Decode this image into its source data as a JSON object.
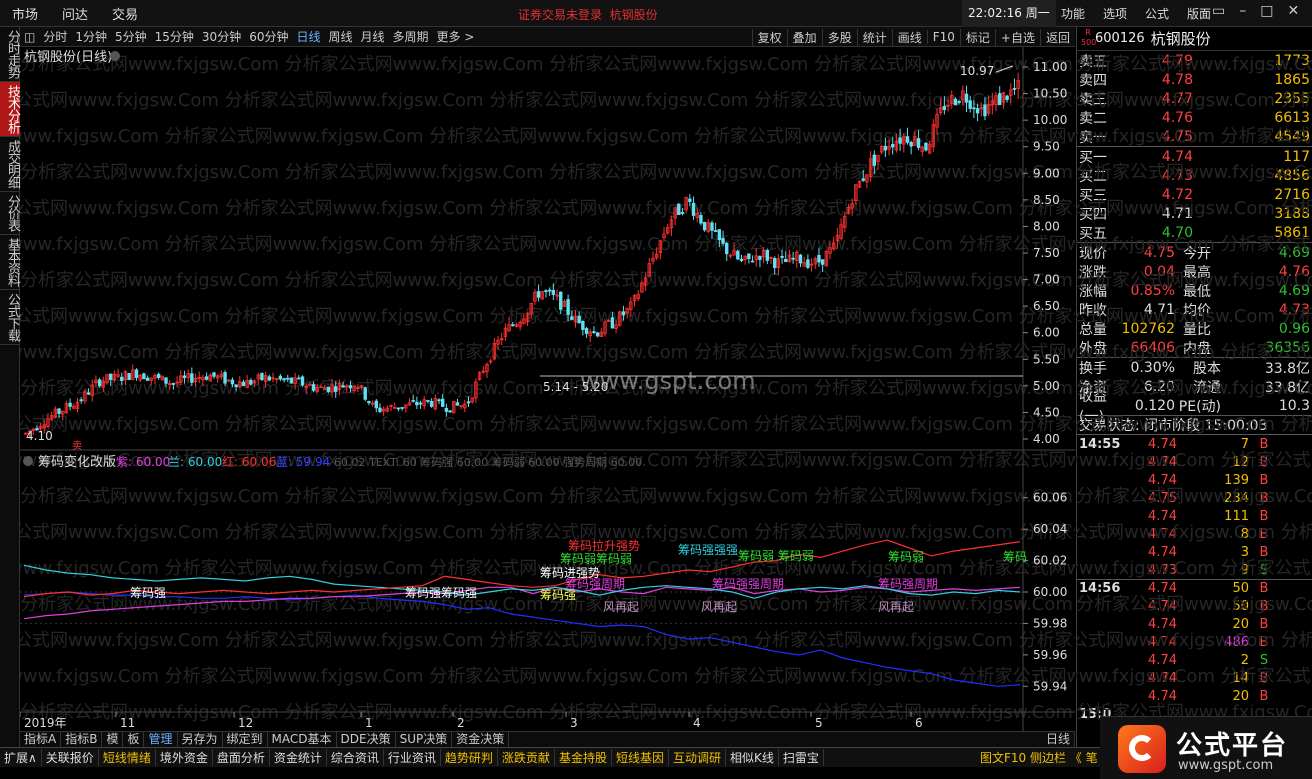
{
  "topbar": {
    "menus": [
      "市场",
      "问达",
      "交易"
    ],
    "notice": "证券交易未登录",
    "stock": "杭钢股份",
    "clock": "22:02:16 周一",
    "right_menus": [
      "功能",
      "选项",
      "公式",
      "版面"
    ],
    "win_buttons": [
      "▭",
      "–",
      "□",
      "✕"
    ]
  },
  "side_tabs": [
    "分时走势",
    "技术分析",
    "成交明细",
    "分价表",
    "基本资料",
    "公式下载"
  ],
  "period_bar": {
    "periods": [
      "分时",
      "1分钟",
      "5分钟",
      "15分钟",
      "30分钟",
      "60分钟",
      "日线",
      "周线",
      "月线",
      "多周期",
      "更多 >"
    ],
    "active": "日线",
    "tools": [
      "复权",
      "叠加",
      "多股",
      "统计",
      "画线",
      "F10",
      "标记",
      "+自选",
      "返回"
    ]
  },
  "main_chart": {
    "title": "杭钢股份(日线)",
    "y_ticks": [
      "11.00",
      "10.50",
      "10.00",
      "9.50",
      "9.00",
      "8.50",
      "8.00",
      "7.50",
      "7.00",
      "6.50",
      "6.00",
      "5.50",
      "5.00",
      "4.50",
      "4.00"
    ],
    "high_label": "10.97",
    "low_label": "4.10",
    "range_label": "5.14 - 5.20",
    "watermark_center": "www.gspt.com"
  },
  "indicator": {
    "name": "筹码变化改版",
    "params": [
      {
        "label": "紫: 60.00",
        "color": "#e040e0"
      },
      {
        "label": "兰: 60.00",
        "color": "#30d0e0"
      },
      {
        "label": "红: 60.06",
        "color": "#ff3030"
      },
      {
        "label": "蓝: 59.94",
        "color": "#3040ff"
      }
    ],
    "overlay": "60.02  TEXT: 60  筹码强  60.00  筹码弱  60.00  强势周期  60.00",
    "y_ticks": [
      "60.06",
      "60.04",
      "60.02",
      "60.00",
      "59.98",
      "59.96",
      "59.94"
    ],
    "annotations": [
      {
        "text": "筹码强",
        "color": "#ffffff"
      },
      {
        "text": "筹码强筹码强",
        "color": "#ffffff"
      },
      {
        "text": "筹码强",
        "color": "#ffff60"
      },
      {
        "text": "筹码进强势",
        "color": "#ffffff"
      },
      {
        "text": "筹码拉升强势",
        "color": "#ff3030"
      },
      {
        "text": "筹码弱筹码弱",
        "color": "#30e030"
      },
      {
        "text": "筹码强周期",
        "color": "#e040e0"
      },
      {
        "text": "风再起",
        "color": "#c090c0"
      },
      {
        "text": "风再起",
        "color": "#c090c0"
      },
      {
        "text": "筹码强强强",
        "color": "#30d0e0"
      },
      {
        "text": "筹码弱 筹码弱",
        "color": "#30e030"
      },
      {
        "text": "筹码强强周期",
        "color": "#e040e0"
      },
      {
        "text": "筹码弱",
        "color": "#30e030"
      },
      {
        "text": "筹码强周期",
        "color": "#e040e0"
      },
      {
        "text": "风再起",
        "color": "#c090c0"
      },
      {
        "text": "筹码",
        "color": "#30e030"
      }
    ],
    "sell_marker": "卖"
  },
  "x_axis": {
    "labels": [
      "2019年",
      "11",
      "12",
      "1",
      "2",
      "3",
      "4",
      "5",
      "6"
    ],
    "period": "日线"
  },
  "indicator_tabs": [
    "指标A",
    "指标B",
    "模",
    "板",
    "管理",
    "另存为",
    "绑定到",
    "MACD基本",
    "DDE决策",
    "SUP决策",
    "资金决策"
  ],
  "indicator_tabs_active": "管理",
  "bottom_bar": {
    "items": [
      "扩展∧",
      "关联报价",
      "短线情绪",
      "境外资金",
      "盘面分析",
      "资金统计",
      "综合资讯",
      "行业资讯",
      "趋势研判",
      "涨跌贡献",
      "基金持股",
      "短线基因",
      "互动调研",
      "相似K线",
      "扫雷宝"
    ],
    "highlighted": [
      "短线情绪",
      "趋势研判",
      "涨跌贡献",
      "基金持股",
      "短线基因",
      "互动调研"
    ],
    "right": "图文F10 侧边栏 《  笔"
  },
  "quote": {
    "badge": "R 500",
    "code": "600126",
    "name": "杭钢股份",
    "asks": [
      {
        "label": "卖五",
        "price": "4.79",
        "vol": "1773"
      },
      {
        "label": "卖四",
        "price": "4.78",
        "vol": "1865"
      },
      {
        "label": "卖三",
        "price": "4.77",
        "vol": "2355"
      },
      {
        "label": "卖二",
        "price": "4.76",
        "vol": "6613"
      },
      {
        "label": "卖一",
        "price": "4.75",
        "vol": "4549"
      }
    ],
    "bids": [
      {
        "label": "买一",
        "price": "4.74",
        "vol": "117"
      },
      {
        "label": "买二",
        "price": "4.73",
        "vol": "4856"
      },
      {
        "label": "买三",
        "price": "4.72",
        "vol": "2716"
      },
      {
        "label": "买四",
        "price": "4.71",
        "vol": "3188"
      },
      {
        "label": "买五",
        "price": "4.70",
        "vol": "5861"
      }
    ],
    "stats": [
      {
        "l1": "现价",
        "v1": "4.75",
        "c1": "red",
        "l2": "今开",
        "v2": "4.69",
        "c2": "grn"
      },
      {
        "l1": "涨跌",
        "v1": "0.04",
        "c1": "red",
        "l2": "最高",
        "v2": "4.76",
        "c2": "red"
      },
      {
        "l1": "涨幅",
        "v1": "0.85%",
        "c1": "red",
        "l2": "最低",
        "v2": "4.69",
        "c2": "grn"
      },
      {
        "l1": "昨收",
        "v1": "4.71",
        "c1": "wht",
        "l2": "均价",
        "v2": "4.73",
        "c2": "red"
      },
      {
        "l1": "总量",
        "v1": "102762",
        "c1": "yel",
        "l2": "量比",
        "v2": "0.96",
        "c2": "grn"
      },
      {
        "l1": "外盘",
        "v1": "66406",
        "c1": "red",
        "l2": "内盘",
        "v2": "36356",
        "c2": "grn"
      }
    ],
    "stats2": [
      {
        "l1": "换手",
        "v1": "0.30%",
        "l2": "股本",
        "v2": "33.8亿"
      },
      {
        "l1": "净资",
        "v1": "6.20",
        "l2": "流通",
        "v2": "33.8亿"
      },
      {
        "l1": "收益(一)",
        "v1": "0.120",
        "l2": "PE(动)",
        "v2": "10.3"
      }
    ],
    "trade_status": "交易状态: 闭市阶段 15:00:03",
    "ticks": [
      {
        "t": "14:55",
        "p": "4.74",
        "v": "7",
        "s": "B"
      },
      {
        "t": "",
        "p": "4.74",
        "v": "12",
        "s": "B"
      },
      {
        "t": "",
        "p": "4.74",
        "v": "139",
        "s": "B"
      },
      {
        "t": "",
        "p": "4.75",
        "v": "234",
        "s": "B"
      },
      {
        "t": "",
        "p": "4.74",
        "v": "111",
        "s": "B"
      },
      {
        "t": "",
        "p": "4.74",
        "v": "8",
        "s": "B"
      },
      {
        "t": "",
        "p": "4.74",
        "v": "3",
        "s": "B"
      },
      {
        "t": "",
        "p": "4.73",
        "v": "9",
        "s": "S"
      },
      {
        "t": "14:56",
        "p": "4.74",
        "v": "50",
        "s": "B"
      },
      {
        "t": "",
        "p": "4.74",
        "v": "50",
        "s": "B"
      },
      {
        "t": "",
        "p": "4.74",
        "v": "20",
        "s": "B"
      },
      {
        "t": "",
        "p": "4.74",
        "v": "486",
        "s": "B"
      },
      {
        "t": "",
        "p": "4.74",
        "v": "2",
        "s": "S"
      },
      {
        "t": "",
        "p": "4.74",
        "v": "14",
        "s": "B"
      },
      {
        "t": "",
        "p": "4.74",
        "v": "20",
        "s": "B"
      },
      {
        "t": "15:0",
        "p": "",
        "v": "",
        "s": ""
      }
    ]
  },
  "logo": {
    "title": "公式平台",
    "url": "www.gspt.com"
  },
  "watermark_text": "分析家公式网www.fxjgsw.Com",
  "colors": {
    "up": "#ff3030",
    "down": "#60e0f0",
    "bg": "#000000",
    "accent_red": "#b01818"
  },
  "chart_data": {
    "type": "candlestick",
    "title": "杭钢股份(日线)",
    "x_labels": [
      "2019年",
      "11",
      "12",
      "1",
      "2",
      "3",
      "4",
      "5",
      "6"
    ],
    "ylim": [
      4.0,
      11.0
    ],
    "close_path": [
      4.1,
      4.35,
      4.55,
      4.75,
      5.1,
      5.15,
      5.25,
      5.15,
      5.05,
      5.15,
      5.2,
      5.1,
      5.05,
      5.15,
      5.1,
      5.05,
      4.95,
      5.0,
      5.05,
      4.55,
      4.6,
      4.65,
      4.7,
      4.6,
      4.65,
      5.4,
      6.0,
      6.3,
      6.8,
      6.6,
      6.2,
      6.0,
      6.2,
      6.5,
      7.3,
      8.1,
      8.5,
      8.0,
      7.6,
      7.3,
      7.5,
      7.3,
      7.4,
      7.3,
      7.6,
      8.6,
      9.2,
      9.6,
      9.7,
      9.5,
      10.3,
      10.5,
      10.2,
      10.4,
      10.6
    ],
    "high": 10.97,
    "low": 4.1,
    "indicator": {
      "ylim": [
        59.93,
        60.07
      ],
      "red": [
        59.997,
        59.999,
        60.0,
        59.998,
        59.999,
        60.001,
        60.0,
        59.999,
        60.0,
        60.001,
        60.0,
        59.999,
        60.0,
        60.001,
        60.0,
        60.001,
        60.002,
        60.003,
        60.004,
        60.01,
        60.008,
        60.006,
        60.004,
        60.003,
        60.004,
        60.008,
        60.011,
        60.009,
        60.01,
        60.012,
        60.014,
        60.013,
        60.016,
        60.019,
        60.02,
        60.024,
        60.022,
        60.026,
        60.03,
        60.033,
        60.028,
        60.023,
        60.026,
        60.028,
        60.03,
        60.032
      ],
      "cyan": [
        60.017,
        60.014,
        60.012,
        60.011,
        60.009,
        60.008,
        60.007,
        60.008,
        60.009,
        60.008,
        60.007,
        60.009,
        60.01,
        60.008,
        60.005,
        60.004,
        60.003,
        60.002,
        60.001,
        60.0,
        59.998,
        60.0,
        60.002,
        60.001,
        60.003,
        60.001,
        59.998,
        60.001,
        60.003,
        60.004,
        60.003,
        60.002,
        60.0,
        59.996,
        60.0,
        60.002,
        60.003,
        60.002,
        60.004,
        60.002,
        59.999,
        59.998,
        60.0,
        59.999,
        60.001,
        60.0
      ],
      "magenta": [
        59.983,
        59.985,
        59.986,
        59.988,
        59.989,
        59.99,
        59.991,
        59.992,
        59.993,
        59.994,
        59.994,
        59.995,
        59.996,
        59.996,
        59.997,
        59.997,
        59.998,
        59.999,
        60.0,
        59.999,
        60.001,
        60.003,
        60.003,
        59.999,
        60.003,
        60.0,
        60.002,
        60.0,
        59.999,
        60.003,
        60.002,
        60.001,
        60.003,
        59.999,
        60.001,
        60.002,
        60.0,
        60.001,
        60.003,
        60.002,
        60.0,
        60.001,
        60.002,
        60.001,
        60.002,
        60.003
      ],
      "blue": [
        59.998,
        59.999,
        60.0,
        59.999,
        59.998,
        59.998,
        59.997,
        59.997,
        59.996,
        59.996,
        59.997,
        59.996,
        59.995,
        59.996,
        59.997,
        59.998,
        59.996,
        59.995,
        59.994,
        59.992,
        59.989,
        59.99,
        59.986,
        59.984,
        59.982,
        59.98,
        59.978,
        59.979,
        59.978,
        59.973,
        59.97,
        59.971,
        59.968,
        59.965,
        59.962,
        59.96,
        59.963,
        59.958,
        59.955,
        59.952,
        59.95,
        59.948,
        59.944,
        59.942,
        59.94,
        59.941
      ]
    }
  }
}
